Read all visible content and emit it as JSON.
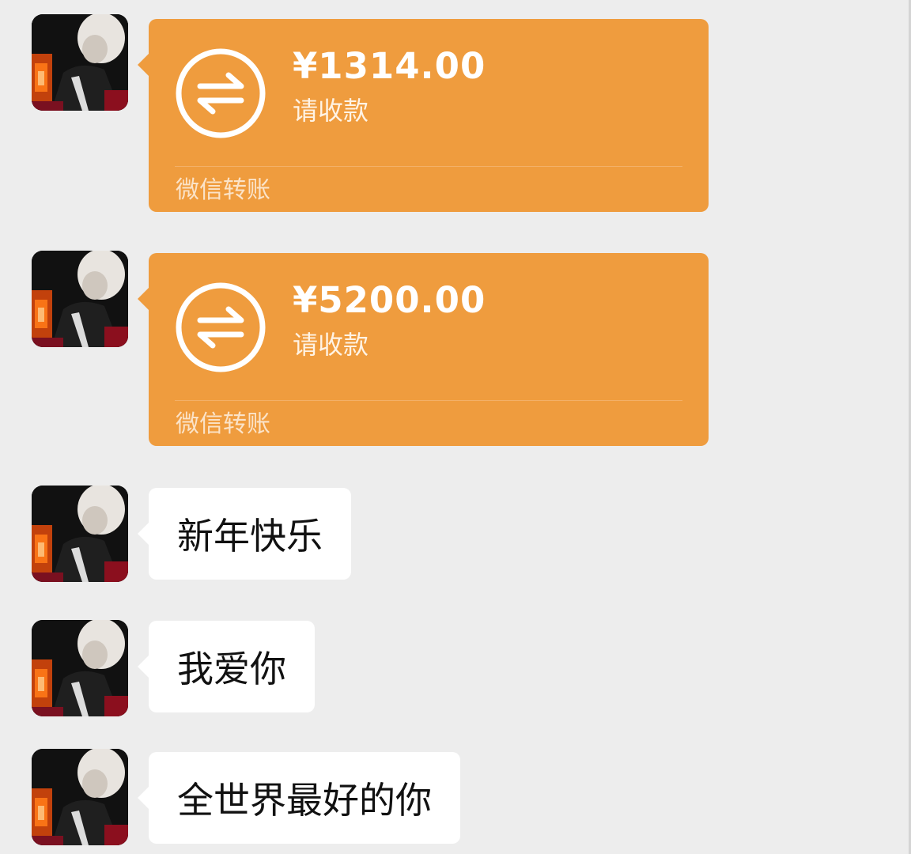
{
  "messages": [
    {
      "type": "transfer",
      "amount": "¥1314.00",
      "action": "请收款",
      "footer": "微信转账",
      "icon": "transfer-arrows-icon"
    },
    {
      "type": "transfer",
      "amount": "¥5200.00",
      "action": "请收款",
      "footer": "微信转账",
      "icon": "transfer-arrows-icon"
    },
    {
      "type": "text",
      "text": "新年快乐"
    },
    {
      "type": "text",
      "text": "我爱你"
    },
    {
      "type": "text",
      "text": "全世界最好的你"
    }
  ],
  "colors": {
    "background": "#ededed",
    "transfer_bubble": "#ef9c3e",
    "text_bubble": "#ffffff",
    "text": "#111111"
  }
}
